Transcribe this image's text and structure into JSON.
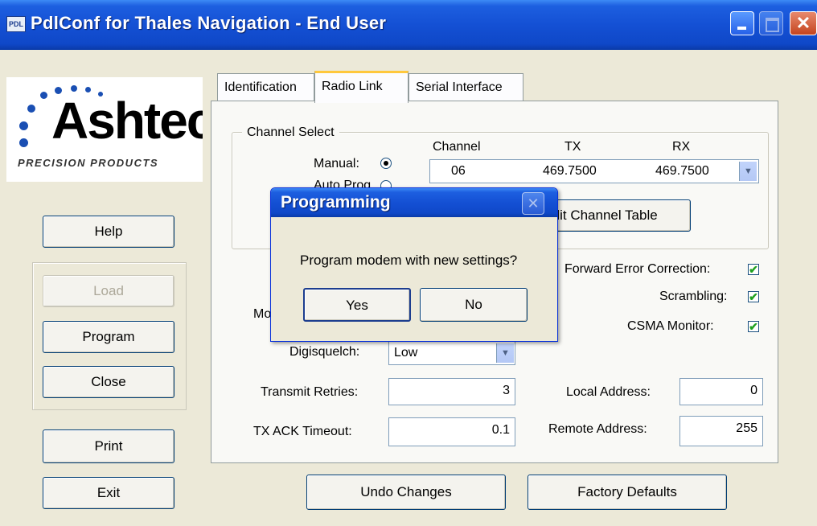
{
  "window": {
    "title": "PdlConf for Thales Navigation - End User",
    "icon_label": "PDL"
  },
  "logo": {
    "text": "Ashtech",
    "subtitle": "Precision Products"
  },
  "left_buttons": {
    "help": "Help",
    "load": "Load",
    "program": "Program",
    "close": "Close",
    "print": "Print",
    "exit": "Exit"
  },
  "tabs": [
    {
      "label": "Identification"
    },
    {
      "label": "Radio Link"
    },
    {
      "label": "Serial Interface"
    }
  ],
  "channel_select": {
    "group_label": "Channel Select",
    "manual_label": "Manual:",
    "auto_label": "Auto Prog",
    "headers": {
      "channel": "Channel",
      "tx": "TX",
      "rx": "RX"
    },
    "selected": {
      "channel": "06",
      "tx": "469.7500",
      "rx": "469.7500"
    },
    "edit_table_button": "Edit Channel Table"
  },
  "options": {
    "fec_label": "Forward Error Correction:",
    "scrambling_label": "Scrambling:",
    "csma_label": "CSMA Monitor:",
    "modulation_label": "Mo",
    "digisquelch_label": "Digisquelch:",
    "digisquelch_value": "Low",
    "transmit_retries_label": "Transmit Retries:",
    "transmit_retries_value": "3",
    "tx_ack_timeout_label": "TX ACK Timeout:",
    "tx_ack_timeout_value": "0.1",
    "local_address_label": "Local Address:",
    "local_address_value": "0",
    "remote_address_label": "Remote Address:",
    "remote_address_value": "255"
  },
  "bottom_buttons": {
    "undo": "Undo Changes",
    "factory": "Factory Defaults"
  },
  "dialog": {
    "title": "Programming",
    "message": "Program modem with new settings?",
    "yes": "Yes",
    "no": "No"
  },
  "icons": {
    "check": "✔",
    "close": "✕",
    "dropdown": "▼",
    "radio_selected": "●"
  }
}
